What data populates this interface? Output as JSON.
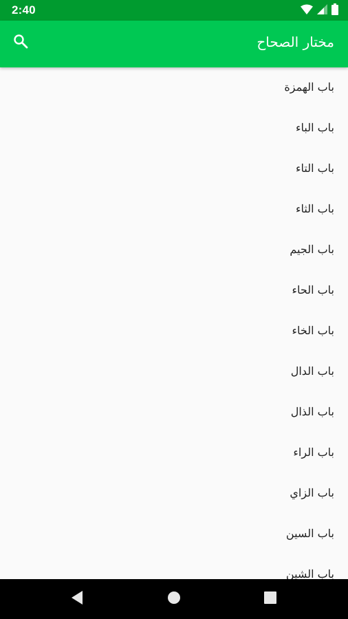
{
  "status_bar": {
    "time": "2:40",
    "icons": [
      "wifi-icon",
      "signal-icon",
      "battery-icon"
    ]
  },
  "app_bar": {
    "title": "مختار الصحاح",
    "search_icon": "search-icon"
  },
  "chapters": [
    {
      "label": "باب الهمزة"
    },
    {
      "label": "باب الباء"
    },
    {
      "label": "باب التاء"
    },
    {
      "label": "باب الثاء"
    },
    {
      "label": "باب الجيم"
    },
    {
      "label": "باب الحاء"
    },
    {
      "label": "باب الخاء"
    },
    {
      "label": "باب الدال"
    },
    {
      "label": "باب الذال"
    },
    {
      "label": "باب الراء"
    },
    {
      "label": "باب الزاي"
    },
    {
      "label": "باب السين"
    },
    {
      "label": "باب الشين"
    }
  ],
  "nav_bar": {
    "buttons": [
      "back-icon",
      "home-icon",
      "recents-icon"
    ]
  },
  "colors": {
    "status_bar": "#009b2f",
    "app_bar": "#00c853",
    "background": "#fafafa",
    "text": "#222222"
  }
}
